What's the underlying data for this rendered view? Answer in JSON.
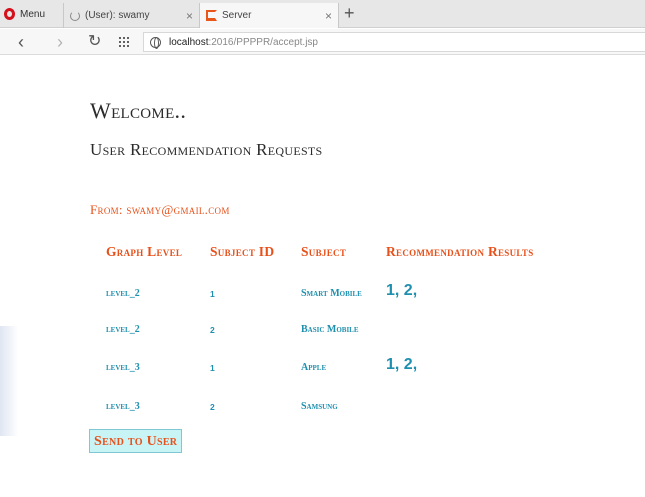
{
  "browser": {
    "menu_label": "Menu",
    "tabs": [
      {
        "label": "(User): swamy",
        "close": "×"
      },
      {
        "label": "Server",
        "close": "×"
      }
    ],
    "new_tab": "+",
    "url_host": "localhost",
    "url_path": ":2016/PPPPR/accept.jsp"
  },
  "page": {
    "welcome": "Welcome..",
    "subtitle": "User Recommendation Requests",
    "from": "From: swamy@gmail.com",
    "table": {
      "headers": [
        "Graph Level",
        "Subject ID",
        "Subject",
        "Recommendation Results"
      ],
      "rows": [
        {
          "level": "level_2",
          "subject_id": "1",
          "subject": "Smart Mobile",
          "results": "1, 2,"
        },
        {
          "level": "level_2",
          "subject_id": "2",
          "subject": "Basic Mobile",
          "results": ""
        },
        {
          "level": "level_3",
          "subject_id": "1",
          "subject": "Apple",
          "results": "1, 2,"
        },
        {
          "level": "level_3",
          "subject_id": "2",
          "subject": "Samsung",
          "results": ""
        }
      ]
    },
    "send_button": "Send to User"
  },
  "colors": {
    "accent_orange": "#e8501a",
    "data_teal": "#1e8fae",
    "button_bg": "#c8f4f6",
    "opera_red": "#d6101b"
  }
}
